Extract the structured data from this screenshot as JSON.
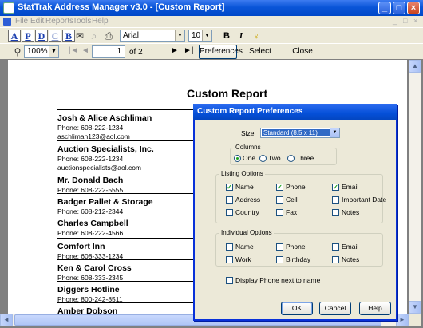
{
  "window": {
    "title": "StatTrak Address Manager v3.0 - [Custom Report]",
    "controls": {
      "minimize": "_",
      "maximize": "□",
      "close": "×"
    }
  },
  "menu": {
    "items": [
      "File",
      "Edit",
      "Reports",
      "Tools",
      "Help"
    ],
    "mdi_controls": [
      "_",
      "□",
      "×"
    ]
  },
  "toolbar": {
    "letter_buttons": [
      "A",
      "P",
      "D",
      "C",
      "B"
    ],
    "font_name": "Arial",
    "font_size": "10",
    "bold": "B",
    "italic": "I"
  },
  "preview_toolbar": {
    "zoom": "100%",
    "page_current": "1",
    "page_of": "of 2",
    "nav": {
      "first": "|◄",
      "prev": "◄",
      "next": "►",
      "last": "►|"
    },
    "preferences_button": "Preferences",
    "select_button": "Select",
    "close_button": "Close"
  },
  "report": {
    "title": "Custom Report",
    "entries": [
      {
        "name": "Josh & Alice Aschliman",
        "phone": "Phone: 608-222-1234",
        "email": "aschliman123@aol.com"
      },
      {
        "name": "Auction Specialists, Inc.",
        "phone": "Phone: 608-222-1234",
        "email": "auctionspecialists@aol.com"
      },
      {
        "name": "Mr. Donald Bach",
        "phone": "Phone: 608-222-5555"
      },
      {
        "name": "Badger Pallet & Storage",
        "phone": "Phone: 608-212-2344"
      },
      {
        "name": "Charles Campbell",
        "phone": "Phone: 608-222-4566"
      },
      {
        "name": "Comfort Inn",
        "phone": "Phone: 608-333-1234"
      },
      {
        "name": "Ken & Carol Cross",
        "phone": "Phone: 608-333-2345"
      },
      {
        "name": "Diggers Hotline",
        "phone": "Phone: 800-242-8511"
      },
      {
        "name": "Amber Dobson"
      }
    ]
  },
  "dialog": {
    "title": "Custom Report Preferences",
    "size_label": "Size",
    "size_value": "Standard (8.5 x 11)",
    "columns": {
      "label": "Columns",
      "options": [
        {
          "label": "One",
          "selected": true
        },
        {
          "label": "Two",
          "selected": false
        },
        {
          "label": "Three",
          "selected": false
        }
      ]
    },
    "listing_options": {
      "label": "Listing Options",
      "items": [
        {
          "label": "Name",
          "checked": true
        },
        {
          "label": "Phone",
          "checked": true
        },
        {
          "label": "Email",
          "checked": true
        },
        {
          "label": "Address",
          "checked": false
        },
        {
          "label": "Cell",
          "checked": false
        },
        {
          "label": "Important Date",
          "checked": false
        },
        {
          "label": "Country",
          "checked": false
        },
        {
          "label": "Fax",
          "checked": false
        },
        {
          "label": "Notes",
          "checked": false
        }
      ]
    },
    "individual_options": {
      "label": "Individual Options",
      "items": [
        {
          "label": "Name",
          "checked": false
        },
        {
          "label": "Phone",
          "checked": false
        },
        {
          "label": "Email",
          "checked": false
        },
        {
          "label": "Work",
          "checked": false
        },
        {
          "label": "Birthday",
          "checked": false
        },
        {
          "label": "Notes",
          "checked": false
        }
      ]
    },
    "display_phone": {
      "label": "Display Phone next to name",
      "checked": false
    },
    "buttons": {
      "ok": "OK",
      "cancel": "Cancel",
      "help": "Help"
    }
  },
  "colors": {
    "titlebar": "#0a55d8",
    "dialog_border": "#0831d9",
    "check": "#21a121",
    "selection": "#316ac5"
  }
}
